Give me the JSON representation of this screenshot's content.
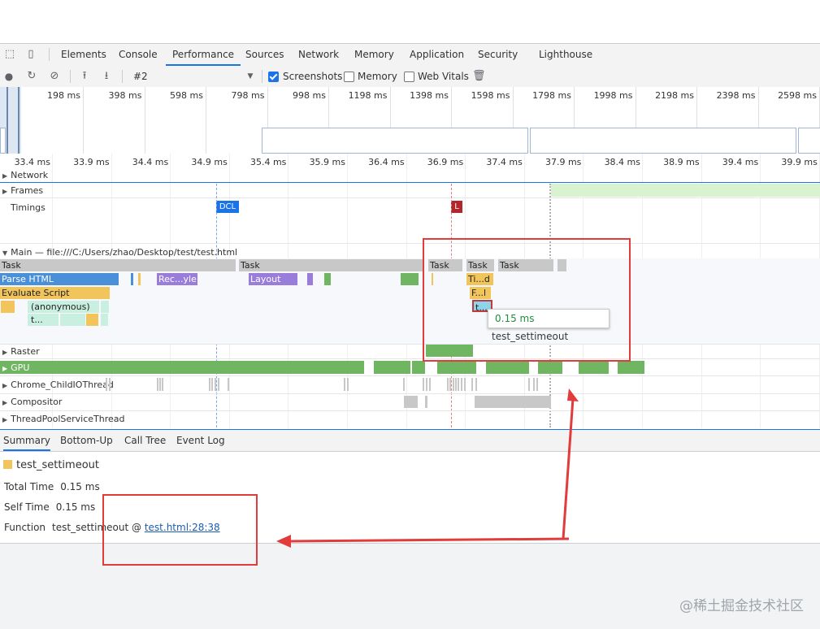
{
  "tabs": [
    "Elements",
    "Console",
    "Performance",
    "Sources",
    "Network",
    "Memory",
    "Application",
    "Security",
    "Lighthouse"
  ],
  "active_tab": "Performance",
  "toolbar": {
    "profile_select": "#2",
    "screenshots_label": "Screenshots",
    "memory_label": "Memory",
    "web_vitals_label": "Web Vitals"
  },
  "overview_ticks": [
    "198 ms",
    "398 ms",
    "598 ms",
    "798 ms",
    "998 ms",
    "1198 ms",
    "1398 ms",
    "1598 ms",
    "1798 ms",
    "1998 ms",
    "2198 ms",
    "2398 ms",
    "2598 ms"
  ],
  "ruler_ticks": [
    "33.4 ms",
    "33.9 ms",
    "34.4 ms",
    "34.9 ms",
    "35.4 ms",
    "35.9 ms",
    "36.4 ms",
    "36.9 ms",
    "37.4 ms",
    "37.9 ms",
    "38.4 ms",
    "38.9 ms",
    "39.4 ms",
    "39.9 ms"
  ],
  "tracks": {
    "network": "Network",
    "frames": "Frames",
    "timings": "Timings",
    "dcl": "DCL",
    "l": "L",
    "main": "Main — file:///C:/Users/zhao/Desktop/test/test.html",
    "raster": "Raster",
    "gpu": "GPU",
    "chrome_child_io": "Chrome_ChildIOThread",
    "compositor": "Compositor",
    "thread_pool": "ThreadPoolServiceThread"
  },
  "flame": {
    "task": "Task",
    "parse_html": "Parse HTML",
    "recalc": "Rec...yle",
    "layout": "Layout",
    "timer": "Ti...d",
    "function_call": "F...l",
    "evaluate_script": "Evaluate Script",
    "anonymous": "(anonymous)",
    "t_short": "t...",
    "t_sel": "t..."
  },
  "tooltip": {
    "time": "0.15 ms",
    "name": "test_settimeout"
  },
  "bottom_tabs": [
    "Summary",
    "Bottom-Up",
    "Call Tree",
    "Event Log"
  ],
  "summary": {
    "title": "test_settimeout",
    "total_time_label": "Total Time",
    "total_time": "0.15 ms",
    "self_time_label": "Self Time",
    "self_time": "0.15 ms",
    "function_label": "Function",
    "function_name": "test_settimeout @",
    "function_link": "test.html:28:38"
  },
  "colors": {
    "accent": "#1a73e8",
    "annotation": "#e23b3b",
    "dcl": "#1a73e8",
    "load": "#b3262b"
  },
  "watermark": "@稀土掘金技术社区"
}
